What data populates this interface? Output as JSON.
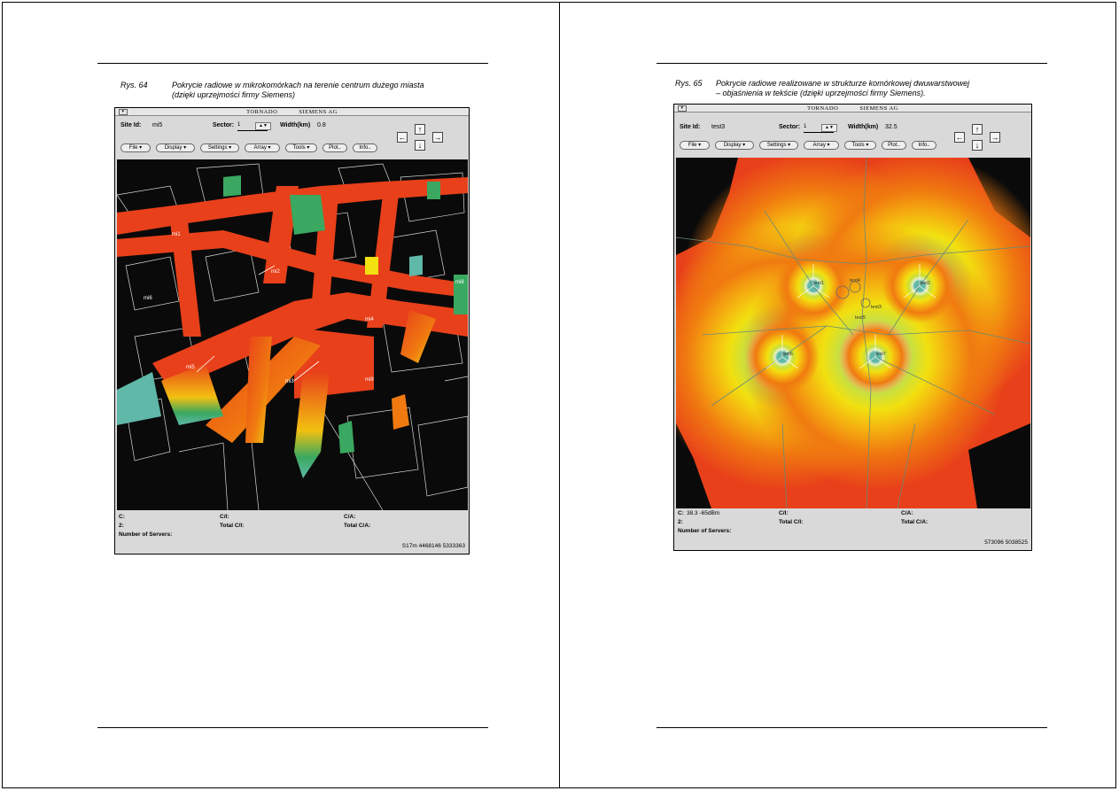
{
  "left": {
    "caption": {
      "fig": "Rys. 64",
      "line1": "Pokrycie radiowe w mikrokomórkach na terenie centrum dużego miasta",
      "line2": "(dzięki uprzejmości firmy Siemens)"
    },
    "window": {
      "title_app": "TORNADO",
      "title_company": "SIEMENS AG",
      "site_label": "Site Id:",
      "site_value": "mi5",
      "sector_label": "Sector:",
      "sector_value": "1",
      "width_label": "Width(km)",
      "width_value": "0.8",
      "menus": [
        "File",
        "Display",
        "Settings",
        "Array",
        "Tools",
        "Plot..",
        "Info.."
      ],
      "map_labels": [
        "mi1",
        "mi2",
        "mi3",
        "mi4",
        "mi5",
        "mi6",
        "mi8",
        "mi9"
      ],
      "status": {
        "c": "C:",
        "c_value": "",
        "ci": "C/I:",
        "ca": "C/A:",
        "two": "2:",
        "total_ci": "Total C/I:",
        "total_ca": "Total C/A:",
        "servers": "Number of Servers:",
        "coords": "S17m 4468146 5333363"
      }
    }
  },
  "right": {
    "caption": {
      "fig": "Rys. 65",
      "line1": "Pokrycie radiowe realizowane w strukturze komórkowej dwuwarstwowej",
      "line2": "– objaśnienia w tekście (dzięki uprzejmości firmy Siemens)."
    },
    "window": {
      "title_app": "TORNADO",
      "title_company": "SIEMENS AG",
      "site_label": "Site Id:",
      "site_value": "test3",
      "sector_label": "Sector:",
      "sector_value": "1",
      "width_label": "Width(km)",
      "width_value": "32.5",
      "menus": [
        "File",
        "Display",
        "Settings",
        "Array",
        "Tools",
        "Plot..",
        "Info.."
      ],
      "map_labels": [
        "test1",
        "test2",
        "test3",
        "test4",
        "test5",
        "test6",
        "test7"
      ],
      "status": {
        "c": "C:",
        "c_value": "38.3 -65dBm",
        "ci": "C/I:",
        "ca": "C/A:",
        "two": "2:",
        "total_ci": "Total C/I:",
        "total_ca": "Total C/A:",
        "servers": "Number of Servers:",
        "coords": "573096 5038525"
      }
    }
  },
  "colors": {
    "map_black": "#0a0a0a",
    "coverage_red": "#e8401a",
    "coverage_orange": "#f07a10",
    "coverage_yellow": "#f2e010",
    "coverage_green": "#3aa860",
    "coverage_teal": "#5fb8a8",
    "window_gray": "#d9d9d9"
  }
}
